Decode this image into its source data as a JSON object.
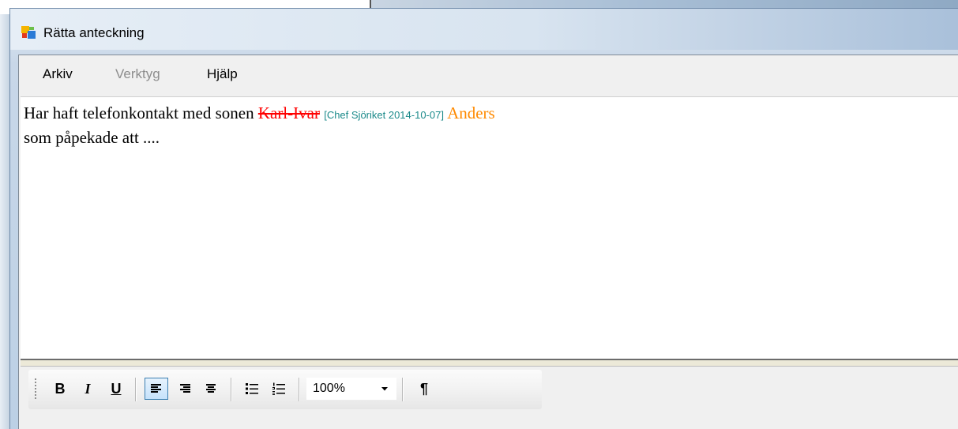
{
  "window": {
    "title": "Rätta anteckning"
  },
  "menu": {
    "file": "Arkiv",
    "tools": "Verktyg",
    "help": "Hjälp"
  },
  "document": {
    "line1_before": "Har haft telefonkontakt med sonen ",
    "deleted_text": "Karl-Ivar",
    "annotation": "[Chef Sjöriket 2014-10-07]",
    "inserted_text": "Anders",
    "line2": "som påpekade att ...."
  },
  "toolbar": {
    "bold": "B",
    "italic": "I",
    "underline": "U",
    "zoom_value": "100%",
    "pilcrow": "¶"
  },
  "colors": {
    "deleted": "#ff0000",
    "annotation": "#1b8a8a",
    "inserted": "#ff8a00",
    "active_button": "#c6e2fb"
  }
}
